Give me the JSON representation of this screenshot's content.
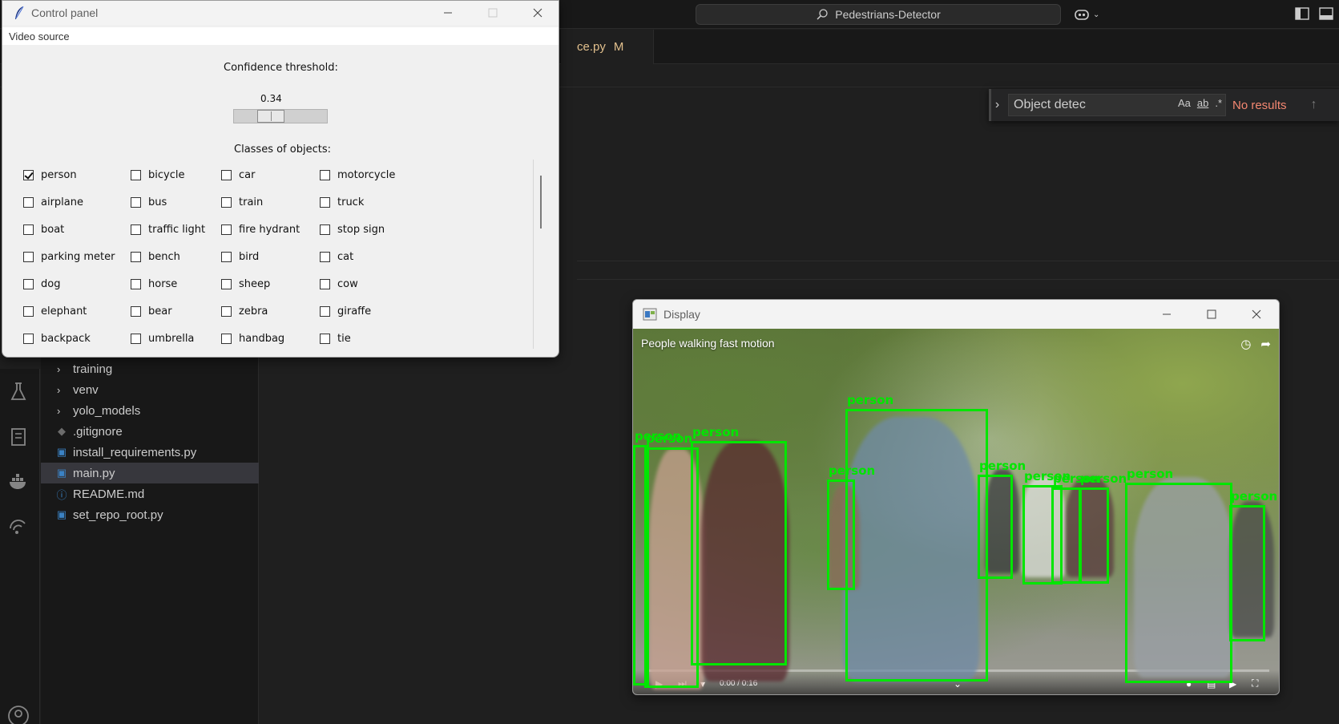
{
  "vscode": {
    "command_center": "Pedestrians-Detector",
    "tab": {
      "name": "ce.py",
      "status": "M"
    },
    "find": {
      "query": "Object detec",
      "match_case": "Aa",
      "whole_word": "ab",
      "regex": ".*",
      "results": "No results"
    },
    "explorer": [
      {
        "name": "training",
        "kind": "folder"
      },
      {
        "name": "venv",
        "kind": "folder"
      },
      {
        "name": "yolo_models",
        "kind": "folder"
      },
      {
        "name": ".gitignore",
        "kind": "git"
      },
      {
        "name": "install_requirements.py",
        "kind": "python"
      },
      {
        "name": "main.py",
        "kind": "python",
        "selected": true
      },
      {
        "name": "README.md",
        "kind": "info"
      },
      {
        "name": "set_repo_root.py",
        "kind": "python"
      }
    ]
  },
  "control_panel": {
    "title": "Control panel",
    "menu": "Video source",
    "confidence_label": "Confidence threshold:",
    "confidence_value": "0.34",
    "classes_label": "Classes of objects:",
    "classes": [
      {
        "name": "person",
        "checked": true
      },
      {
        "name": "bicycle",
        "checked": false
      },
      {
        "name": "car",
        "checked": false
      },
      {
        "name": "motorcycle",
        "checked": false
      },
      {
        "name": "airplane",
        "checked": false
      },
      {
        "name": "bus",
        "checked": false
      },
      {
        "name": "train",
        "checked": false
      },
      {
        "name": "truck",
        "checked": false
      },
      {
        "name": "boat",
        "checked": false
      },
      {
        "name": "traffic light",
        "checked": false
      },
      {
        "name": "fire hydrant",
        "checked": false
      },
      {
        "name": "stop sign",
        "checked": false
      },
      {
        "name": "parking meter",
        "checked": false
      },
      {
        "name": "bench",
        "checked": false
      },
      {
        "name": "bird",
        "checked": false
      },
      {
        "name": "cat",
        "checked": false
      },
      {
        "name": "dog",
        "checked": false
      },
      {
        "name": "horse",
        "checked": false
      },
      {
        "name": "sheep",
        "checked": false
      },
      {
        "name": "cow",
        "checked": false
      },
      {
        "name": "elephant",
        "checked": false
      },
      {
        "name": "bear",
        "checked": false
      },
      {
        "name": "zebra",
        "checked": false
      },
      {
        "name": "giraffe",
        "checked": false
      },
      {
        "name": "backpack",
        "checked": false
      },
      {
        "name": "umbrella",
        "checked": false
      },
      {
        "name": "handbag",
        "checked": false
      },
      {
        "name": "tie",
        "checked": false
      }
    ]
  },
  "display": {
    "title": "Display",
    "video_title": "People walking fast motion",
    "time": "0:00 / 0:16",
    "detection_label": "person",
    "box_color": "#00e600"
  }
}
